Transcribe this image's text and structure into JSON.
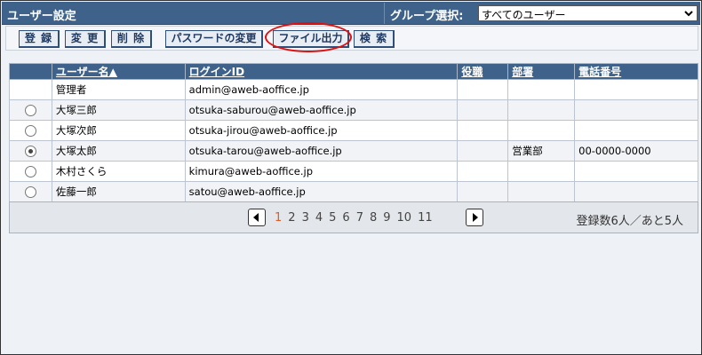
{
  "header": {
    "title": "ユーザー設定",
    "group_label": "グループ選択:",
    "group_value": "すべてのユーザー"
  },
  "toolbar": {
    "buttons": [
      "登 録",
      "変 更",
      "削 除",
      "パスワードの変更",
      "ファイル出力",
      "検 索"
    ]
  },
  "table": {
    "columns": [
      "",
      "ユーザー名▲",
      "ログインID",
      "役職",
      "部署",
      "電話番号"
    ],
    "rows": [
      {
        "radio": "none",
        "name": "管理者",
        "login": "admin@aweb-aoffice.jp",
        "title": "",
        "dept": "",
        "phone": ""
      },
      {
        "radio": "unchecked",
        "name": "大塚三郎",
        "login": "otsuka-saburou@aweb-aoffice.jp",
        "title": "",
        "dept": "",
        "phone": ""
      },
      {
        "radio": "unchecked",
        "name": "大塚次郎",
        "login": "otsuka-jirou@aweb-aoffice.jp",
        "title": "",
        "dept": "",
        "phone": ""
      },
      {
        "radio": "checked",
        "name": "大塚太郎",
        "login": "otsuka-tarou@aweb-aoffice.jp",
        "title": "",
        "dept": "営業部",
        "phone": "00-0000-0000"
      },
      {
        "radio": "unchecked",
        "name": "木村さくら",
        "login": "kimura@aweb-aoffice.jp",
        "title": "",
        "dept": "",
        "phone": ""
      },
      {
        "radio": "unchecked",
        "name": "佐藤一郎",
        "login": "satou@aweb-aoffice.jp",
        "title": "",
        "dept": "",
        "phone": ""
      }
    ]
  },
  "pager": {
    "pages": [
      "1",
      "2",
      "3",
      "4",
      "5",
      "6",
      "7",
      "8",
      "9",
      "10",
      "11"
    ],
    "current": "1",
    "count_text": "登録数6人／あと5人"
  },
  "colors": {
    "header_bg": "#3e6289",
    "highlight_ring": "#e01010",
    "current_page": "#e85a1a"
  },
  "icons": {
    "select_arrow": "chevron-down-icon",
    "prev": "prev-page-icon",
    "next": "next-page-icon"
  }
}
